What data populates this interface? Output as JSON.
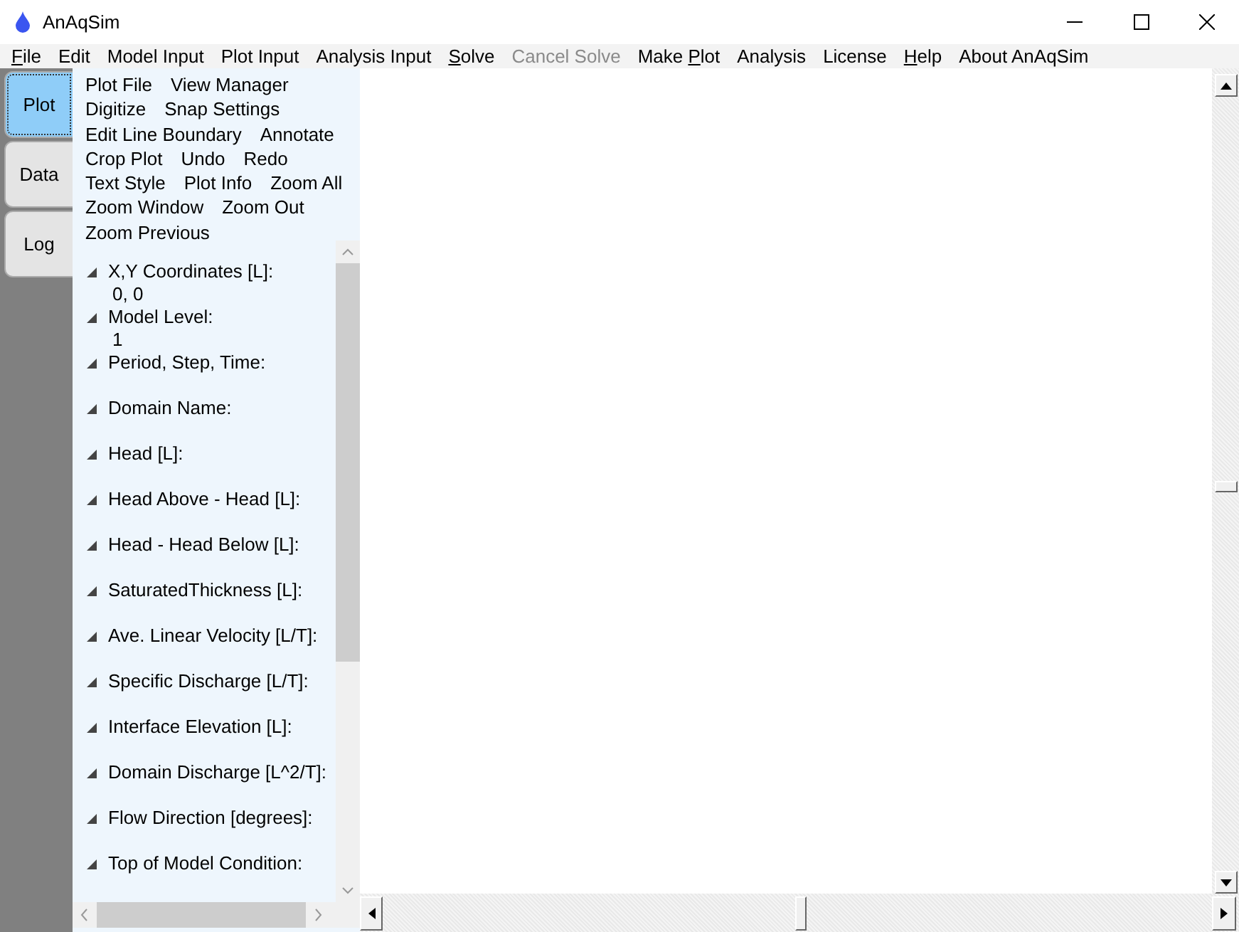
{
  "window": {
    "title": "AnAqSim"
  },
  "menu": [
    {
      "key": "F",
      "after": "ile",
      "disabled": false
    },
    {
      "label": "Edit",
      "disabled": false
    },
    {
      "label": "Model Input",
      "disabled": false
    },
    {
      "label": "Plot Input",
      "disabled": false
    },
    {
      "label": "Analysis Input",
      "disabled": false
    },
    {
      "key": "S",
      "after": "olve",
      "disabled": false
    },
    {
      "label": "Cancel Solve",
      "disabled": true
    },
    {
      "before": "Make ",
      "key": "P",
      "after": "lot",
      "disabled": false
    },
    {
      "label": "Analysis",
      "disabled": false
    },
    {
      "label": "License",
      "disabled": false
    },
    {
      "key": "H",
      "after": "elp",
      "disabled": false
    },
    {
      "label": "About AnAqSim",
      "disabled": false
    }
  ],
  "side_tabs": [
    {
      "label": "Plot",
      "selected": true
    },
    {
      "label": "Data",
      "selected": false
    },
    {
      "label": "Log",
      "selected": false
    }
  ],
  "commands": [
    [
      "Plot File",
      "View Manager"
    ],
    [
      "Digitize",
      "Snap Settings"
    ],
    [
      "Edit Line Boundary",
      "Annotate"
    ],
    [
      "Crop Plot",
      "Undo",
      "Redo"
    ],
    [
      "Text Style",
      "Plot Info",
      "Zoom All"
    ],
    [
      "Zoom Window",
      "Zoom Out"
    ],
    [
      "Zoom Previous"
    ]
  ],
  "info": [
    {
      "label": "X,Y Coordinates [L]:",
      "value": "0, 0",
      "expanded": true
    },
    {
      "label": "Model Level:",
      "value": "1",
      "expanded": true
    },
    {
      "label": "Period, Step, Time:",
      "expanded": true
    },
    {
      "label": "Domain Name:",
      "expanded": true
    },
    {
      "label": "Head [L]:",
      "expanded": true
    },
    {
      "label": "Head Above - Head [L]:",
      "expanded": true
    },
    {
      "label": "Head - Head Below [L]:",
      "expanded": true
    },
    {
      "label": "SaturatedThickness [L]:",
      "expanded": true
    },
    {
      "label": "Ave. Linear Velocity [L/T]:",
      "expanded": true
    },
    {
      "label": "Specific Discharge [L/T]:",
      "expanded": true
    },
    {
      "label": "Interface Elevation [L]:",
      "expanded": true
    },
    {
      "label": "Domain Discharge [L^2/T]:",
      "expanded": true
    },
    {
      "label": "Flow Direction [degrees]:",
      "expanded": true
    },
    {
      "label": "Top of Model Condition:",
      "expanded": true
    }
  ]
}
